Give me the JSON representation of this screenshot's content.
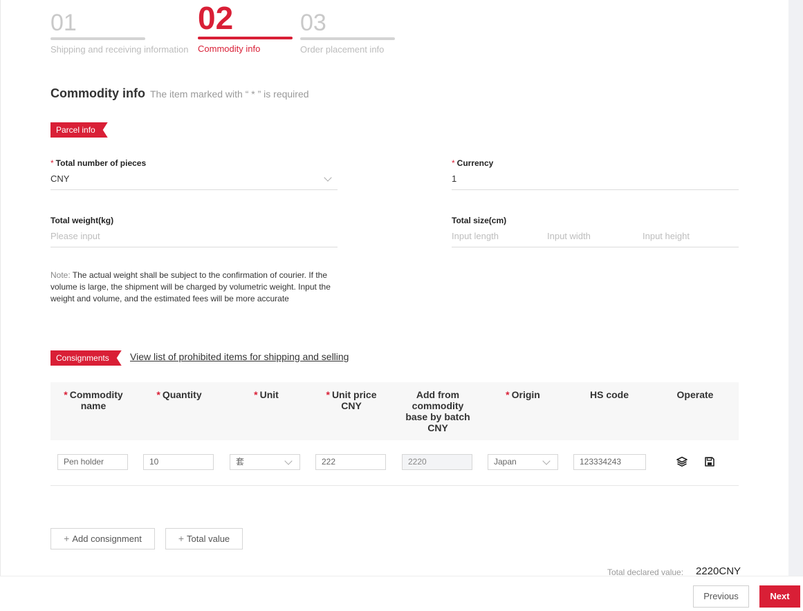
{
  "steps": [
    {
      "number": "01",
      "label": "Shipping and receiving information",
      "active": false
    },
    {
      "number": "02",
      "label": "Commodity info",
      "active": true
    },
    {
      "number": "03",
      "label": "Order placement info",
      "active": false
    }
  ],
  "section": {
    "title": "Commodity info",
    "hint": "The item marked with “ * ” is required"
  },
  "parcel": {
    "tag": "Parcel info",
    "required_mark": "*",
    "total_pieces": {
      "label": "Total number of pieces",
      "value": "CNY"
    },
    "currency": {
      "label": "Currency",
      "value": "1"
    },
    "total_weight": {
      "label": "Total weight(kg)",
      "placeholder": "Please input"
    },
    "total_size": {
      "label": "Total size(cm)",
      "length_placeholder": "Input length",
      "width_placeholder": "Input width",
      "height_placeholder": "Input height"
    },
    "note_prefix": "Note:",
    "note_text": " The actual weight shall be subject to the confirmation of courier. If the volume is large, the shipment will be charged by volumetric weight. Input the weight and volume, and the estimated fees will be more accurate"
  },
  "consignments": {
    "tag": "Consignments",
    "prohibited_link": "View list of prohibited items for shipping and selling",
    "columns": {
      "commodity_name": "Commodity name",
      "quantity": "Quantity",
      "unit": "Unit",
      "unit_price": "Unit price CNY",
      "add_from_base": "Add from commodity base by batch CNY",
      "origin": "Origin",
      "hs_code": "HS code",
      "operate": "Operate"
    },
    "row": {
      "commodity_name": "Pen holder",
      "quantity": "10",
      "unit": "套",
      "unit_price": "222",
      "total": "2220",
      "origin": "Japan",
      "hs_code": "123334243"
    },
    "add_consignment": "Add consignment",
    "total_value": "Total value",
    "plus_glyph": "+"
  },
  "summary": {
    "label": "Total declared value:",
    "value": "2220CNY"
  },
  "footer": {
    "previous": "Previous",
    "next": "Next"
  },
  "colors": {
    "accent": "#d91f36",
    "muted": "#bcbcbc"
  }
}
